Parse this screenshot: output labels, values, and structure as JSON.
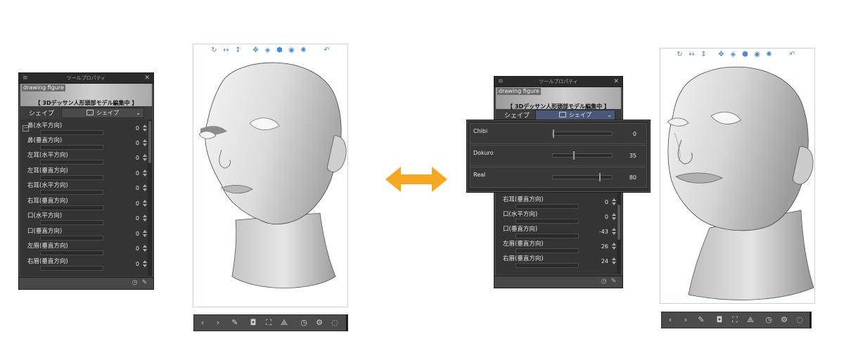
{
  "panel": {
    "title": "ツールプロパティ",
    "preview_tag": "drawing figure",
    "preview_subtitle": "【 3Dデッサン人形頭部モデル編集中 】",
    "shape_label": "シェイプ",
    "shape_dropdown": "シェイプ"
  },
  "left_params": [
    {
      "label": "鼻(水平方向)",
      "value": "0"
    },
    {
      "label": "鼻(垂直方向)",
      "value": "0"
    },
    {
      "label": "左耳(水平方向)",
      "value": "0"
    },
    {
      "label": "左耳(垂直方向)",
      "value": "0"
    },
    {
      "label": "右耳(水平方向)",
      "value": "0"
    },
    {
      "label": "右耳(垂直方向)",
      "value": "0"
    },
    {
      "label": "口(水平方向)",
      "value": "0"
    },
    {
      "label": "口(垂直方向)",
      "value": "0"
    },
    {
      "label": "左眉(垂直方向)",
      "value": "0"
    },
    {
      "label": "右眉(垂直方向)",
      "value": "0"
    }
  ],
  "right_params": [
    {
      "label": "右耳(垂直方向)",
      "value": "0"
    },
    {
      "label": "口(水平方向)",
      "value": "0"
    },
    {
      "label": "口(垂直方向)",
      "value": "-43"
    },
    {
      "label": "左眉(垂直方向)",
      "value": "26"
    },
    {
      "label": "右眉(垂直方向)",
      "value": "24"
    }
  ],
  "presets": [
    {
      "name": "Chibi",
      "value": "0",
      "level": 0.0
    },
    {
      "name": "Dokuro",
      "value": "35",
      "level": 0.35
    },
    {
      "name": "Real",
      "value": "80",
      "level": 0.8
    }
  ],
  "colors": {
    "arrow": "#f5a623",
    "viewport_icons": "#4a8ad4",
    "panel_bg": "#3a3a3a"
  },
  "viewport_icons": [
    "rotate-icon",
    "pan-x-icon",
    "pan-y-icon",
    "move-icon",
    "camera-rotate-icon",
    "camera-pan-icon",
    "camera-zoom-icon",
    "light-icon",
    "undo-icon"
  ],
  "bottombar_icons": [
    "prev-icon",
    "next-icon",
    "wrench-icon",
    "camera-icon",
    "fit-frame-icon",
    "floor-icon",
    "reset-pose-icon",
    "reset-camera-icon",
    "reset-light-icon"
  ]
}
